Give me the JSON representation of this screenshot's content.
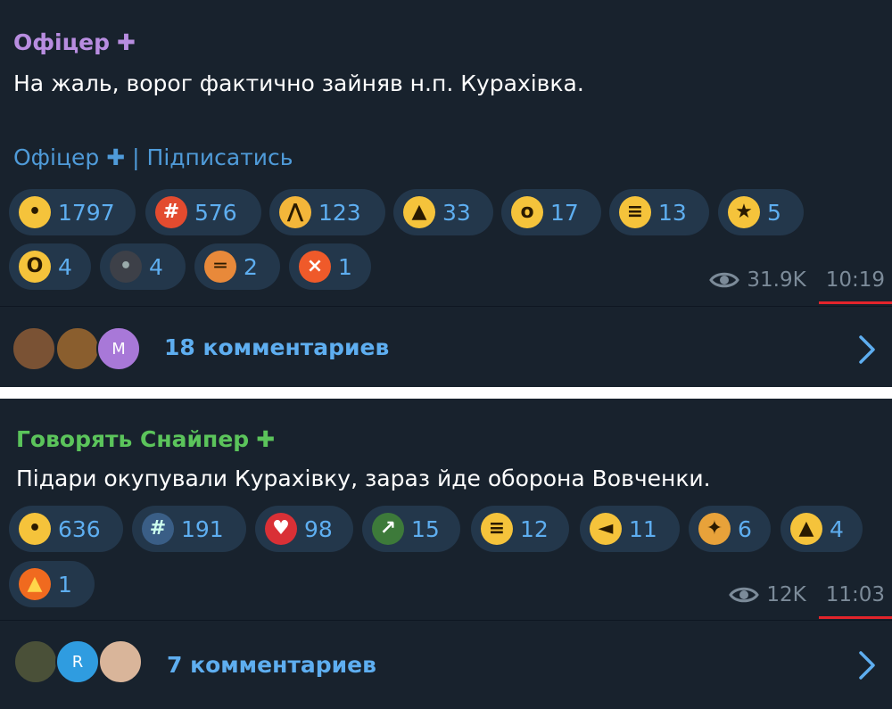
{
  "posts": [
    {
      "author": "Офіцер",
      "author_plus": "✚",
      "author_color": "#b88de0",
      "text": "На жаль, ворог фактично зайняв н.п. Курахівка.",
      "signature_name": "Офіцер",
      "signature_plus": "✚",
      "signature_sep": "|",
      "signature_link": "Підписатись",
      "reactions": [
        {
          "icon": "crying-face-icon",
          "glyph": "•",
          "count": "1797"
        },
        {
          "icon": "cursing-face-icon",
          "glyph": "#",
          "count": "576"
        },
        {
          "icon": "folded-hands-icon",
          "glyph": "⋀",
          "count": "123"
        },
        {
          "icon": "thumbs-up-icon",
          "glyph": "▲",
          "count": "33"
        },
        {
          "icon": "fearful-face-icon",
          "glyph": "o",
          "count": "17"
        },
        {
          "icon": "grimacing-face-icon",
          "glyph": "≡",
          "count": "13"
        },
        {
          "icon": "star-struck-face-icon",
          "glyph": "★",
          "count": "5"
        },
        {
          "icon": "screaming-face-icon",
          "glyph": "O",
          "count": "4"
        },
        {
          "icon": "new-moon-face-icon",
          "glyph": "•",
          "count": "4"
        },
        {
          "icon": "hot-dog-icon",
          "glyph": "═",
          "count": "2"
        },
        {
          "icon": "angry-face-icon",
          "glyph": "×",
          "count": "1"
        }
      ],
      "views": "31.9K",
      "time": "10:19",
      "comments": "18 комментариев",
      "avatars": [
        "",
        "",
        "M"
      ]
    },
    {
      "author": "Говорять Снайпер",
      "author_plus": "✚",
      "author_color": "#5bc45b",
      "text": "Підари окупували Курахівку, зараз йде оборона Вовченки.",
      "reactions": [
        {
          "icon": "crying-face-icon",
          "glyph": "•",
          "count": "636"
        },
        {
          "icon": "cursing-face-icon",
          "glyph": "#",
          "count": "191"
        },
        {
          "icon": "broken-heart-icon",
          "glyph": "♥",
          "count": "98"
        },
        {
          "icon": "champagne-icon",
          "glyph": "↗",
          "count": "15"
        },
        {
          "icon": "grimacing-face-icon",
          "glyph": "≡",
          "count": "12"
        },
        {
          "icon": "pointing-hand-icon",
          "glyph": "◄",
          "count": "11"
        },
        {
          "icon": "party-popper-icon",
          "glyph": "✦",
          "count": "6"
        },
        {
          "icon": "thumbs-up-icon",
          "glyph": "▲",
          "count": "4"
        },
        {
          "icon": "fire-icon",
          "glyph": "▲",
          "count": "1"
        }
      ],
      "views": "12K",
      "time": "11:03",
      "comments": "7 комментариев",
      "avatars": [
        "",
        "R",
        ""
      ]
    }
  ],
  "colors": {
    "background": "#18222d",
    "accent": "#5eaef0",
    "link": "#4f9bd9",
    "reaction_bg": "#23374b",
    "meta": "#7c8b99",
    "highlight_underline": "#e3242b"
  }
}
